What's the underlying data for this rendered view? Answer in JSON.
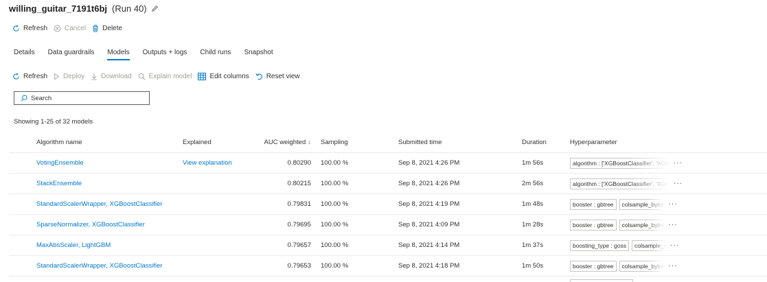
{
  "header": {
    "run_name": "willing_guitar_7191t6bj",
    "run_number": "(Run 40)"
  },
  "commands": {
    "refresh": "Refresh",
    "cancel": "Cancel",
    "delete": "Delete"
  },
  "tabs": [
    {
      "label": "Details"
    },
    {
      "label": "Data guardrails"
    },
    {
      "label": "Models",
      "active": true
    },
    {
      "label": "Outputs + logs"
    },
    {
      "label": "Child runs"
    },
    {
      "label": "Snapshot"
    }
  ],
  "toolbar": {
    "refresh": "Refresh",
    "deploy": "Deploy",
    "download": "Download",
    "explain": "Explain model",
    "edit_columns": "Edit columns",
    "reset_view": "Reset view"
  },
  "search": {
    "placeholder": "Search"
  },
  "showing_text": "Showing 1-25 of 32 models",
  "table": {
    "columns": {
      "algorithm": "Algorithm name",
      "explained": "Explained",
      "auc": "AUC weighted",
      "sort_arrow": "↓",
      "sampling": "Sampling",
      "submitted": "Submitted time",
      "duration": "Duration",
      "hyper": "Hyperparameter"
    },
    "rows": [
      {
        "algorithm": "VotingEnsemble",
        "explained": "View explanation",
        "auc": "0.80290",
        "sampling": "100.00 %",
        "submitted": "Sep 8, 2021 4:26 PM",
        "duration": "1m 56s",
        "tag1": "algorithm : ['XGBoostClassifier', 'XGB",
        "tag2": "",
        "more": "···"
      },
      {
        "algorithm": "StackEnsemble",
        "explained": "",
        "auc": "0.80215",
        "sampling": "100.00 %",
        "submitted": "Sep 8, 2021 4:26 PM",
        "duration": "2m 56s",
        "tag1": "algorithm : ['XGBoostClassifier', 'XGB",
        "tag2": "",
        "more": "···"
      },
      {
        "algorithm": "StandardScalerWrapper, XGBoostClassifier",
        "explained": "",
        "auc": "0.79831",
        "sampling": "100.00 %",
        "submitted": "Sep 8, 2021 4:19 PM",
        "duration": "1m 48s",
        "tag1": "booster : gbtree",
        "tag2": "colsample_bytree",
        "more": "···"
      },
      {
        "algorithm": "SparseNormalizer, XGBoostClassifier",
        "explained": "",
        "auc": "0.79695",
        "sampling": "100.00 %",
        "submitted": "Sep 8, 2021 4:09 PM",
        "duration": "1m 28s",
        "tag1": "booster : gbtree",
        "tag2": "colsample_bytree",
        "more": "···"
      },
      {
        "algorithm": "MaxAbsScaler, LightGBM",
        "explained": "",
        "auc": "0.79657",
        "sampling": "100.00 %",
        "submitted": "Sep 8, 2021 4:14 PM",
        "duration": "1m 37s",
        "tag1": "boosting_type : goss",
        "tag2": "colsample_bytree",
        "more": "···"
      },
      {
        "algorithm": "StandardScalerWrapper, XGBoostClassifier",
        "explained": "",
        "auc": "0.79653",
        "sampling": "100.00 %",
        "submitted": "Sep 8, 2021 4:18 PM",
        "duration": "1m 50s",
        "tag1": "booster : gbtree",
        "tag2": "colsample_bytree",
        "more": "···"
      }
    ]
  },
  "colors": {
    "accent": "#0078d4",
    "text": "#323130",
    "disabled": "#a19f9d",
    "border": "#edebe9"
  }
}
